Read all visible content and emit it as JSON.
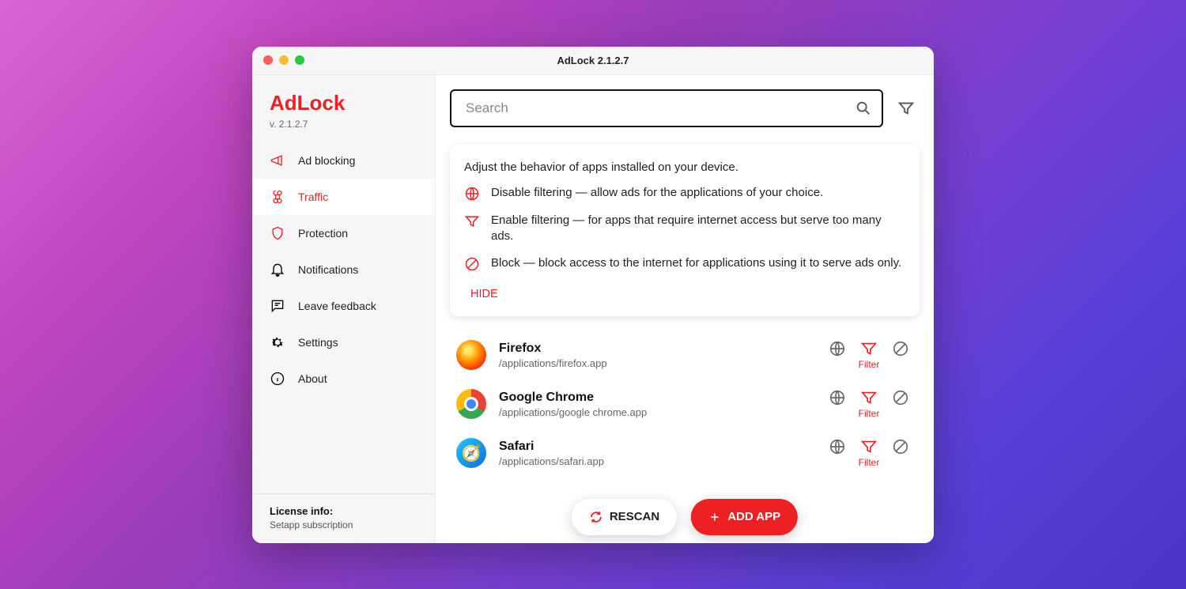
{
  "window": {
    "title": "AdLock 2.1.2.7"
  },
  "brand": {
    "name": "AdLock",
    "version": "v. 2.1.2.7"
  },
  "sidebar": {
    "items": [
      {
        "label": "Ad blocking"
      },
      {
        "label": "Traffic"
      },
      {
        "label": "Protection"
      },
      {
        "label": "Notifications"
      },
      {
        "label": "Leave feedback"
      },
      {
        "label": "Settings"
      },
      {
        "label": "About"
      }
    ]
  },
  "license": {
    "title": "License info:",
    "sub": "Setapp subscription"
  },
  "search": {
    "placeholder": "Search"
  },
  "info": {
    "heading": "Adjust the behavior of apps installed on your device.",
    "rows": [
      "Disable filtering — allow ads for the applications of your choice.",
      "Enable filtering — for apps that require internet access but serve too many ads.",
      "Block — block access to the internet for applications using it to serve ads only."
    ],
    "hide": "HIDE"
  },
  "apps": [
    {
      "name": "Firefox",
      "path": "/applications/firefox.app",
      "status": "Filter"
    },
    {
      "name": "Google Chrome",
      "path": "/applications/google chrome.app",
      "status": "Filter"
    },
    {
      "name": "Safari",
      "path": "/applications/safari.app",
      "status": "Filter"
    }
  ],
  "buttons": {
    "rescan": "RESCAN",
    "add": "ADD APP"
  }
}
